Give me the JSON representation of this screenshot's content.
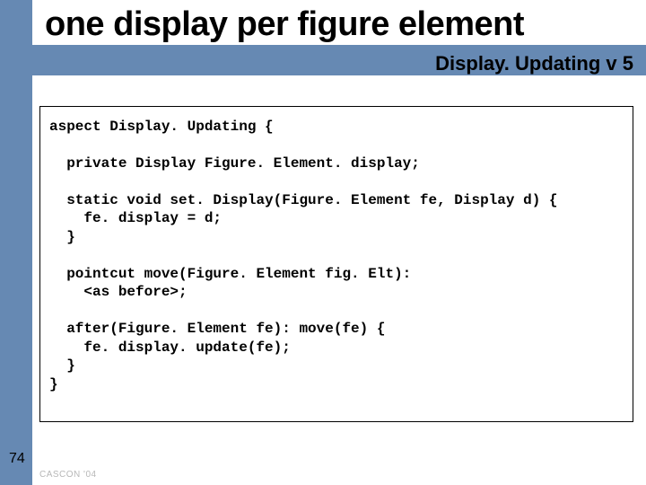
{
  "header": {
    "title": "one display per figure element",
    "subtitle": "Display. Updating v 5"
  },
  "code": {
    "line1": "aspect Display. Updating {",
    "line2": "",
    "line3": "  private Display Figure. Element. display;",
    "line4": "",
    "line5": "  static void set. Display(Figure. Element fe, Display d) {",
    "line6": "    fe. display = d;",
    "line7": "  }",
    "line8": "",
    "line9": "  pointcut move(Figure. Element fig. Elt):",
    "line10": "    <as before>;",
    "line11": "",
    "line12": "  after(Figure. Element fe): move(fe) {",
    "line13": "    fe. display. update(fe);",
    "line14": "  }",
    "line15": "}"
  },
  "footer": {
    "page_number": "74",
    "conference": "CASCON '04"
  }
}
